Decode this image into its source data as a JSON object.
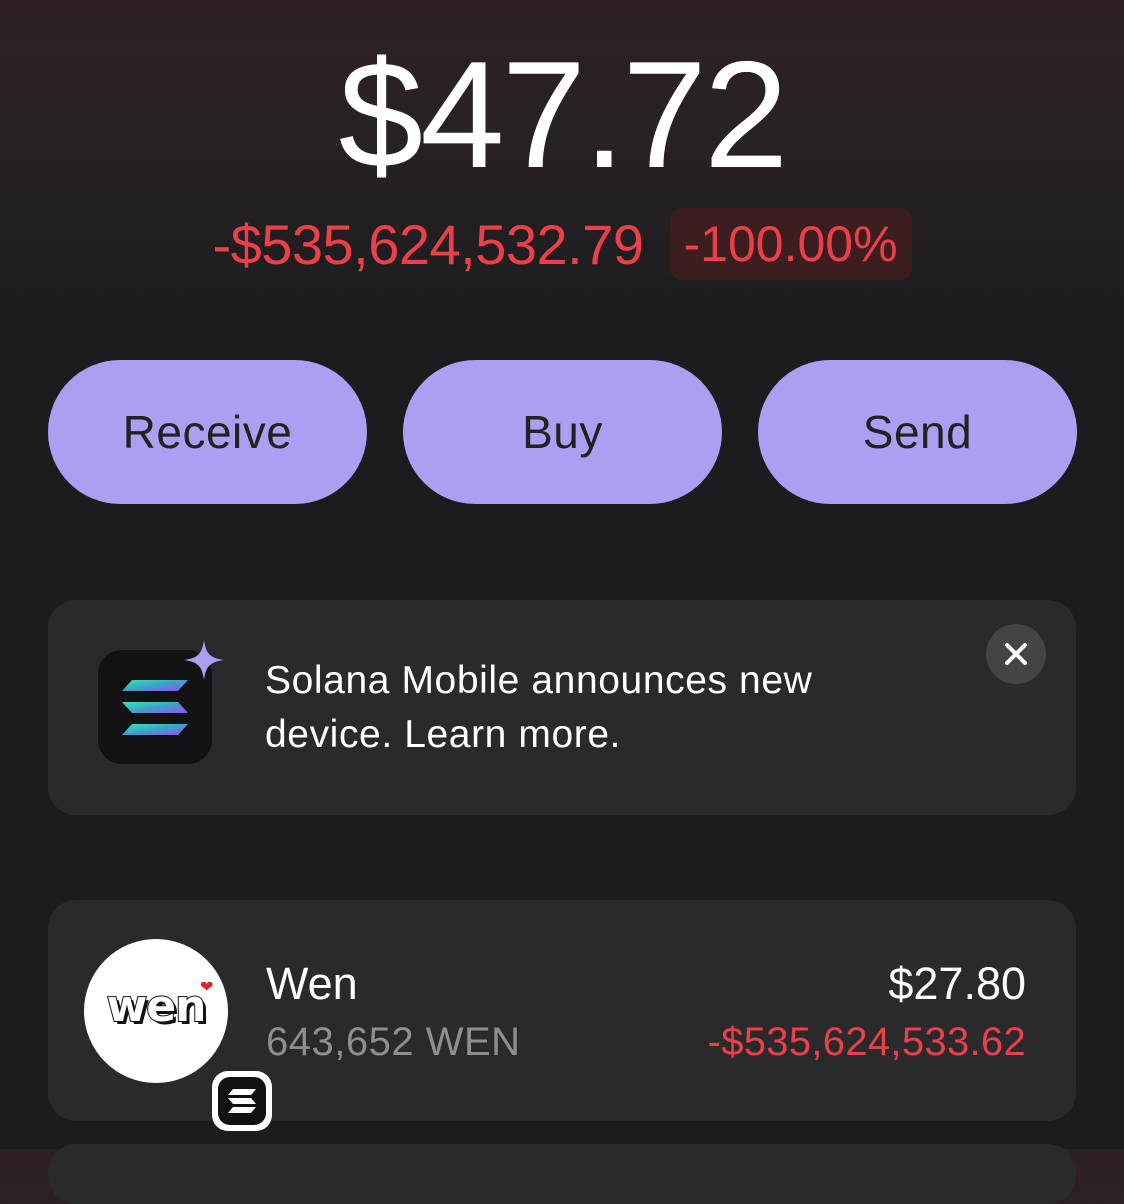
{
  "balance": {
    "total": "$47.72",
    "change_amount": "-$535,624,532.79",
    "change_percent": "-100.00%",
    "change_color": "#ec3f49"
  },
  "actions": {
    "receive_label": "Receive",
    "buy_label": "Buy",
    "send_label": "Send",
    "button_color": "#ab9ff2"
  },
  "promo": {
    "icon": "solana-logo-icon",
    "sparkle_icon": "sparkle-icon",
    "text": "Solana Mobile announces new device. Learn more.",
    "close_icon": "close-icon"
  },
  "tokens": [
    {
      "name": "Wen",
      "logo_text": "wen",
      "amount": "643,652 WEN",
      "value": "$27.80",
      "change": "-$535,624,533.62",
      "chain_icon": "solana-chain-icon"
    }
  ]
}
